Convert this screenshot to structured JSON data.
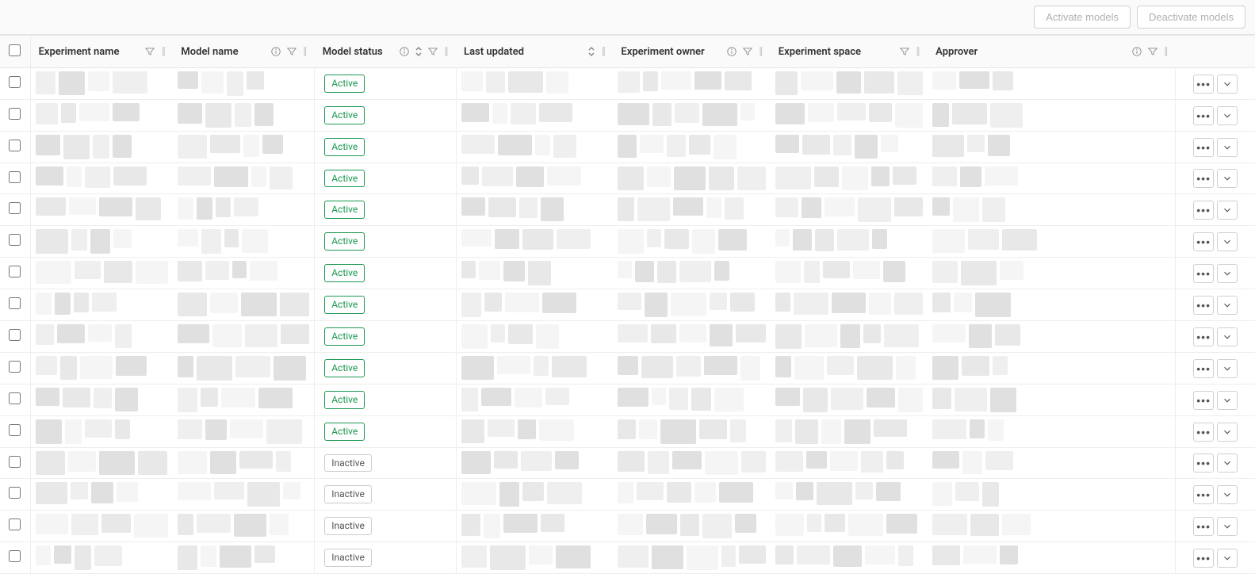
{
  "toolbar": {
    "activate_label": "Activate models",
    "deactivate_label": "Deactivate models"
  },
  "columns": {
    "experiment_name": "Experiment name",
    "model_name": "Model name",
    "model_status": "Model status",
    "last_updated": "Last updated",
    "experiment_owner": "Experiment owner",
    "experiment_space": "Experiment space",
    "approver": "Approver"
  },
  "status_labels": {
    "active": "Active",
    "inactive": "Inactive"
  },
  "rows": [
    {
      "status": "active"
    },
    {
      "status": "active"
    },
    {
      "status": "active"
    },
    {
      "status": "active"
    },
    {
      "status": "active"
    },
    {
      "status": "active"
    },
    {
      "status": "active"
    },
    {
      "status": "active"
    },
    {
      "status": "active"
    },
    {
      "status": "active"
    },
    {
      "status": "active"
    },
    {
      "status": "active"
    },
    {
      "status": "inactive"
    },
    {
      "status": "inactive"
    },
    {
      "status": "inactive"
    },
    {
      "status": "inactive"
    }
  ],
  "colors": {
    "active_badge": "#1a9850",
    "inactive_badge_text": "#555",
    "inactive_badge_border": "#ccc"
  }
}
